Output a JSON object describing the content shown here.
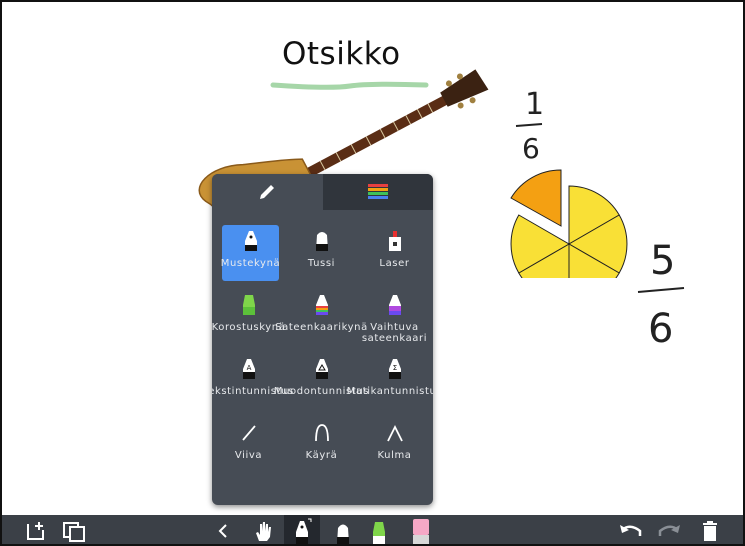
{
  "canvas": {
    "title": "Otsikko",
    "fraction_small": {
      "numerator": "1",
      "denominator": "6"
    },
    "fraction_large": {
      "numerator": "5",
      "denominator": "6"
    },
    "pie": {
      "slices": 6,
      "detached_slices": 1,
      "fill": "#f9e036",
      "detached_fill": "#f4a012"
    },
    "underline_color": "#a6d6a8"
  },
  "panel": {
    "tabs": [
      {
        "icon": "pencil-icon",
        "active": true
      },
      {
        "icon": "colors-icon",
        "active": false
      }
    ],
    "tools": [
      {
        "label": "Mustekynä",
        "icon": "marker-pen-icon",
        "selected": true
      },
      {
        "label": "Tussi",
        "icon": "felt-tip-icon",
        "selected": false
      },
      {
        "label": "Laser",
        "icon": "laser-icon",
        "selected": false
      },
      {
        "label": "Korostuskynä",
        "icon": "highlighter-icon",
        "selected": false
      },
      {
        "label": "Sateenkaarikynä",
        "icon": "rainbow-pen-icon",
        "selected": false
      },
      {
        "label": "Vaihtuva sateenkaari",
        "icon": "gradient-rainbow-pen-icon",
        "selected": false
      },
      {
        "label": "Tekstintunnistus",
        "icon": "text-recognition-pen-icon",
        "selected": false
      },
      {
        "label": "Muodontunnistus",
        "icon": "shape-recognition-pen-icon",
        "selected": false
      },
      {
        "label": "Matikantunnistus",
        "icon": "math-recognition-pen-icon",
        "selected": false
      },
      {
        "label": "Viiva",
        "icon": "line-icon",
        "selected": false
      },
      {
        "label": "Käyrä",
        "icon": "curve-icon",
        "selected": false
      },
      {
        "label": "Kulma",
        "icon": "angle-icon",
        "selected": false
      }
    ]
  },
  "toolbar": {
    "items": [
      "add-page-icon",
      "duplicate-page-icon",
      "chevron-left-icon",
      "hand-icon",
      "pen-icon",
      "felt-tip-icon",
      "highlighter-green-icon",
      "eraser-pink-icon",
      "undo-icon",
      "redo-icon",
      "trash-icon"
    ]
  },
  "colors": {
    "panel": "#464c55",
    "panel_tab_inactive": "#30353c",
    "selected": "#4a90f0",
    "toolbar": "#3b4047"
  }
}
